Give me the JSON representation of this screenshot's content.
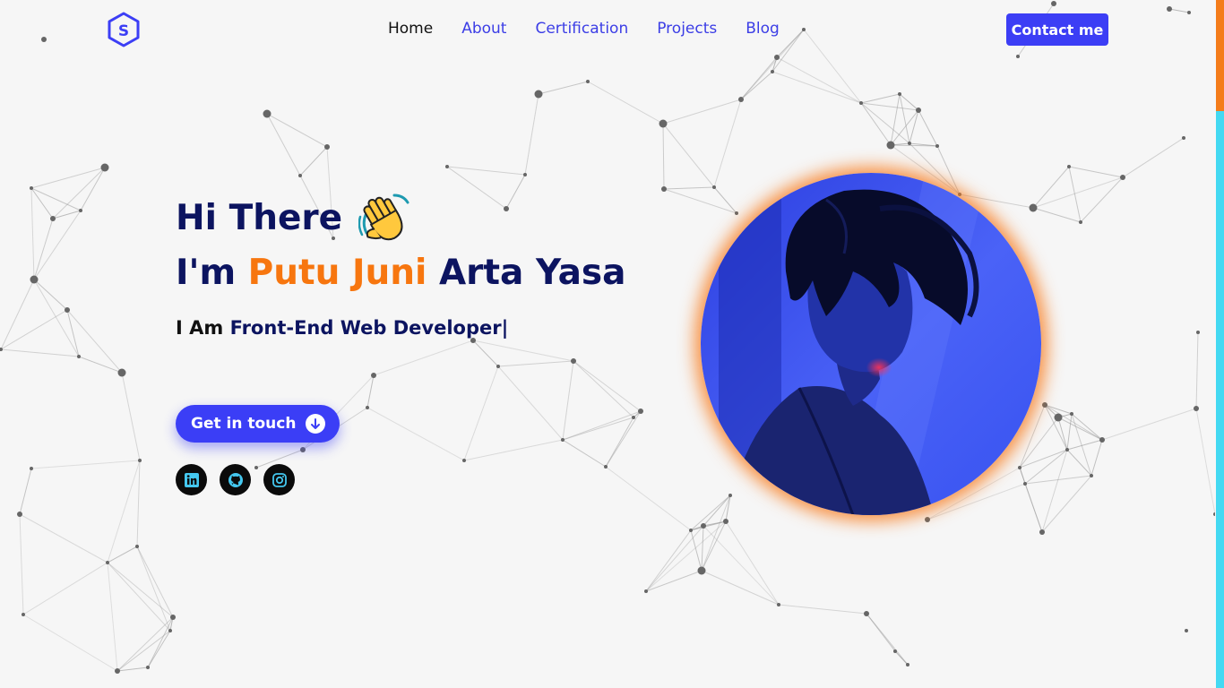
{
  "header": {
    "logo_letter": "S",
    "nav": [
      {
        "label": "Home",
        "active": true
      },
      {
        "label": "About"
      },
      {
        "label": "Certification"
      },
      {
        "label": "Projects"
      },
      {
        "label": "Blog"
      }
    ],
    "contact_label": "Contact me"
  },
  "hero": {
    "greeting": "Hi There",
    "intro_prefix": "I'm ",
    "name_highlight": "Putu Juni",
    "name_rest": " Arta Yasa",
    "role_prefix": "I Am ",
    "role_typed": "Front-End Web Developer",
    "cursor": "|",
    "cta_label": "Get in touch"
  },
  "socials": [
    {
      "name": "linkedin-icon"
    },
    {
      "name": "github-icon"
    },
    {
      "name": "instagram-icon"
    }
  ],
  "colors": {
    "accent_blue": "#3c3ef5",
    "navy": "#0c1460",
    "orange": "#f7760f",
    "social_icon": "#44c8f0",
    "scrollbar_track": "#44d9f2",
    "scrollbar_thumb": "#f47c1a"
  }
}
